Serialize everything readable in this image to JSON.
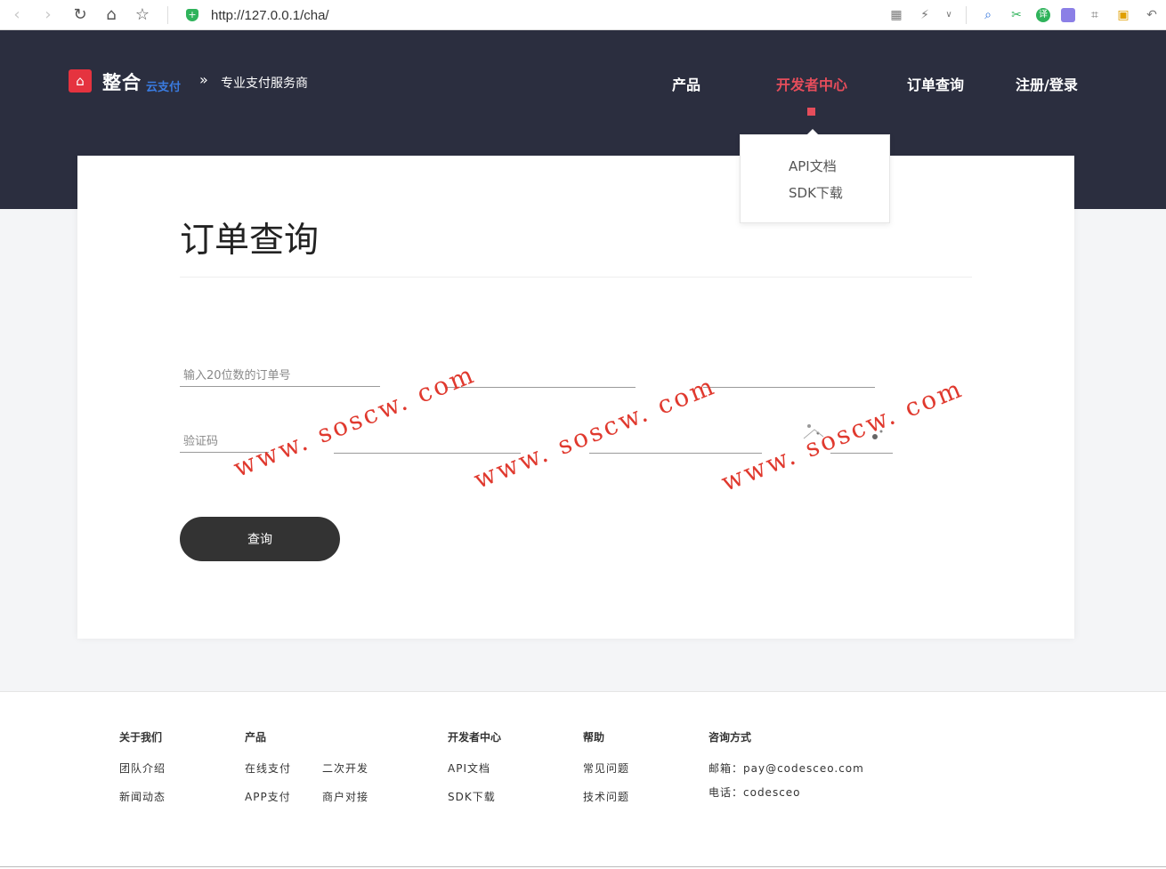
{
  "browser": {
    "url": "http://127.0.0.1/cha/"
  },
  "header": {
    "brand": "整合",
    "brand_sub": "云支付",
    "slogan": "专业支付服务商",
    "nav": [
      {
        "label": "产品"
      },
      {
        "label": "开发者中心"
      },
      {
        "label": "订单查询"
      },
      {
        "label": "注册/登录"
      }
    ],
    "dropdown": [
      "API文档",
      "SDK下载"
    ]
  },
  "main": {
    "title": "订单查询",
    "order_placeholder": "输入20位数的订单号",
    "captcha_placeholder": "验证码",
    "query_label": "查询"
  },
  "watermark": "www. soscw. com",
  "colors": {
    "header_bg": "#2b2e3f",
    "accent": "#e54d5b",
    "button_bg": "#333333"
  },
  "footer": {
    "about": {
      "title": "关于我们",
      "links": [
        "团队介绍",
        "新闻动态"
      ]
    },
    "product": {
      "title": "产品",
      "links": [
        "在线支付",
        "二次开发",
        "APP支付",
        "商户对接"
      ]
    },
    "dev": {
      "title": "开发者中心",
      "links": [
        "API文档",
        "SDK下载"
      ]
    },
    "help": {
      "title": "帮助",
      "links": [
        "常见问题",
        "技术问题"
      ]
    },
    "contact": {
      "title": "咨询方式",
      "email": "邮箱：pay@codesceo.com",
      "phone": "电话：codesceo"
    }
  }
}
